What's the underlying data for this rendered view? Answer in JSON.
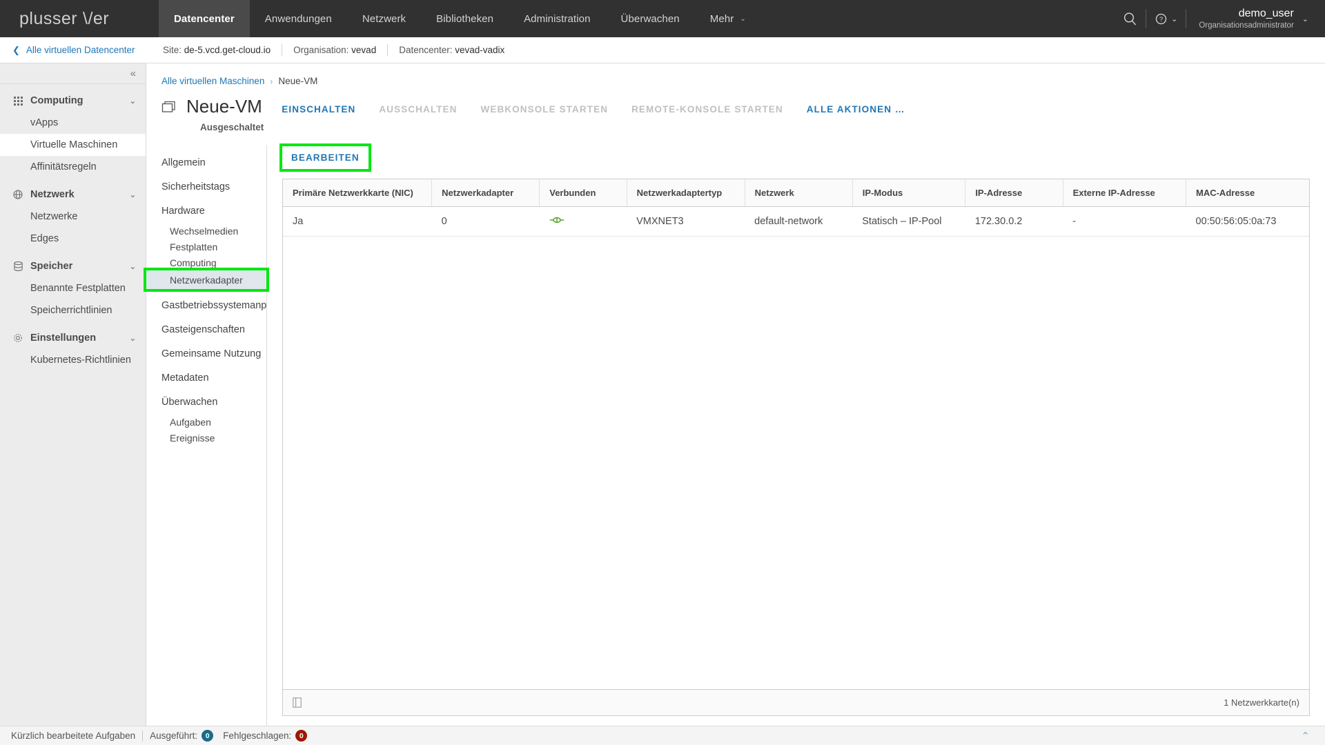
{
  "header": {
    "logo_text": "plusserver",
    "nav": [
      {
        "label": "Datencenter",
        "active": true
      },
      {
        "label": "Anwendungen",
        "active": false
      },
      {
        "label": "Netzwerk",
        "active": false
      },
      {
        "label": "Bibliotheken",
        "active": false
      },
      {
        "label": "Administration",
        "active": false
      },
      {
        "label": "Überwachen",
        "active": false
      },
      {
        "label": "Mehr",
        "active": false,
        "caret": "⌄"
      }
    ],
    "search_icon": "search-icon",
    "help_icon": "help-icon",
    "user": {
      "name": "demo_user",
      "role": "Organisationsadministrator",
      "caret": "⌄"
    }
  },
  "sitebar": {
    "back_label": "Alle virtuellen Datencenter",
    "back_chevron": "❮",
    "site_label": "Site:",
    "site_value": "de-5.vcd.get-cloud.io",
    "org_label": "Organisation:",
    "org_value": "vevad",
    "dc_label": "Datencenter:",
    "dc_value": "vevad-vadix"
  },
  "sidebar": {
    "collapse_icon": "«",
    "groups": [
      {
        "label": "Computing",
        "icon": "grid-icon",
        "caret": "⌄",
        "items": [
          {
            "label": "vApps",
            "selected": false
          },
          {
            "label": "Virtuelle Maschinen",
            "selected": true
          },
          {
            "label": "Affinitätsregeln",
            "selected": false
          }
        ]
      },
      {
        "label": "Netzwerk",
        "icon": "network-icon",
        "caret": "⌄",
        "items": [
          {
            "label": "Netzwerke",
            "selected": false
          },
          {
            "label": "Edges",
            "selected": false
          }
        ]
      },
      {
        "label": "Speicher",
        "icon": "storage-icon",
        "caret": "⌄",
        "items": [
          {
            "label": "Benannte Festplatten",
            "selected": false
          },
          {
            "label": "Speicherrichtlinien",
            "selected": false
          }
        ]
      },
      {
        "label": "Einstellungen",
        "icon": "gear-icon",
        "caret": "⌄",
        "items": [
          {
            "label": "Kubernetes-Richtlinien",
            "selected": false
          }
        ]
      }
    ]
  },
  "breadcrumb": {
    "root": "Alle virtuellen Maschinen",
    "separator": "›",
    "current": "Neue-VM"
  },
  "vm": {
    "icon": "vm-icon",
    "name": "Neue-VM",
    "state": "Ausgeschaltet",
    "actions": [
      {
        "label": "EINSCHALTEN",
        "disabled": false
      },
      {
        "label": "AUSSCHALTEN",
        "disabled": true
      },
      {
        "label": "WEBKONSOLE STARTEN",
        "disabled": true
      },
      {
        "label": "REMOTE-KONSOLE STARTEN",
        "disabled": true
      },
      {
        "label": "ALLE AKTIONEN …",
        "disabled": false
      }
    ]
  },
  "vmnav": {
    "items": [
      {
        "label": "Allgemein",
        "level": "top",
        "selected": false,
        "highlight": false
      },
      {
        "label": "Sicherheitstags",
        "level": "top",
        "selected": false,
        "highlight": false
      },
      {
        "label": "Hardware",
        "level": "top",
        "selected": false,
        "highlight": false
      },
      {
        "label": "Wechselmedien",
        "level": "sub",
        "selected": false,
        "highlight": false
      },
      {
        "label": "Festplatten",
        "level": "sub",
        "selected": false,
        "highlight": false
      },
      {
        "label": "Computing",
        "level": "sub",
        "selected": false,
        "highlight": false
      },
      {
        "label": "Netzwerkadapter",
        "level": "sub",
        "selected": true,
        "highlight": true
      },
      {
        "label": "Gastbetriebssystemanpassung",
        "level": "top",
        "selected": false,
        "highlight": false
      },
      {
        "label": "Gasteigenschaften",
        "level": "top",
        "selected": false,
        "highlight": false
      },
      {
        "label": "Gemeinsame Nutzung",
        "level": "top",
        "selected": false,
        "highlight": false
      },
      {
        "label": "Metadaten",
        "level": "top",
        "selected": false,
        "highlight": false
      },
      {
        "label": "Überwachen",
        "level": "top",
        "selected": false,
        "highlight": false
      },
      {
        "label": "Aufgaben",
        "level": "sub",
        "selected": false,
        "highlight": false
      },
      {
        "label": "Ereignisse",
        "level": "sub",
        "selected": false,
        "highlight": false
      }
    ]
  },
  "panel": {
    "edit_button": "BEARBEITEN",
    "edit_highlighted": true,
    "columns": [
      "Primäre Netzwerkkarte (NIC)",
      "Netzwerkadapter",
      "Verbunden",
      "Netzwerkadaptertyp",
      "Netzwerk",
      "IP-Modus",
      "IP-Adresse",
      "Externe IP-Adresse",
      "MAC-Adresse"
    ],
    "rows": [
      {
        "primary_nic": "Ja",
        "adapter_index": "0",
        "connected_icon": "connected-plug-icon",
        "adapter_type": "VMXNET3",
        "network": "default-network",
        "ip_mode": "Statisch – IP-Pool",
        "ip_address": "172.30.0.2",
        "external_ip": "-",
        "mac_address": "00:50:56:05:0a:73"
      }
    ],
    "footer_columns_icon": "columns-icon",
    "footer_count": "1 Netzwerkkarte(n)"
  },
  "statusbar": {
    "tasks_label": "Kürzlich bearbeitete Aufgaben",
    "executed_label": "Ausgeführt:",
    "executed_count": "0",
    "failed_label": "Fehlgeschlagen:",
    "failed_count": "0",
    "expand_icon": "⌃"
  },
  "colors": {
    "accent_blue": "#1f77b4",
    "topbar_bg": "#313131",
    "highlight_green": "#00e713",
    "selected_row": "#dfe7ed",
    "badge_ok": "#1b6a8c",
    "badge_fail": "#9e1800",
    "connected_green": "#5a9e2f"
  }
}
